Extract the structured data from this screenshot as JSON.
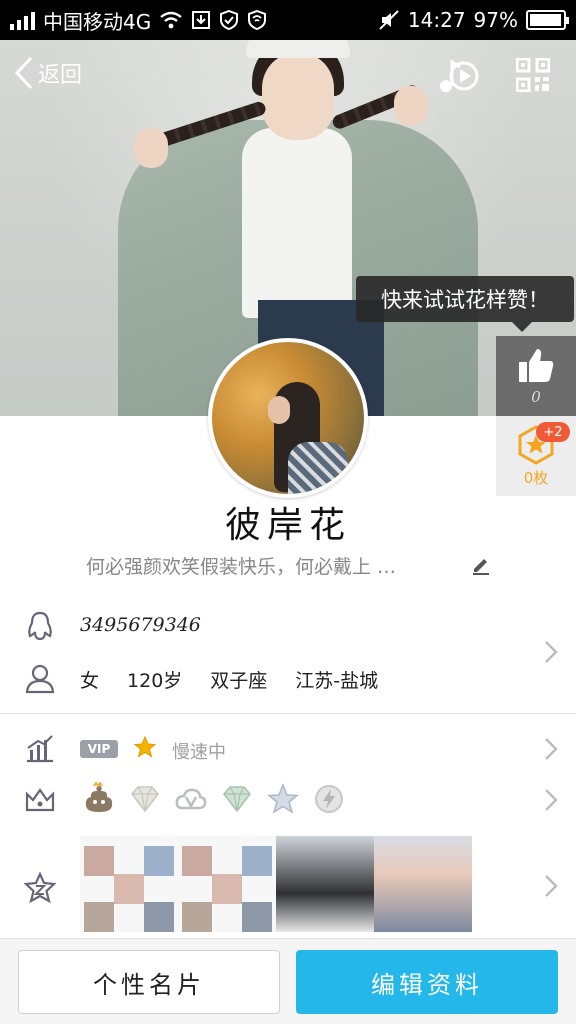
{
  "status_bar": {
    "carrier": "中国移动4G",
    "time": "14:27",
    "battery": "97%",
    "battery_level": 0.97
  },
  "header": {
    "back_label": "返回",
    "music_icon": "music-play-icon",
    "qr_icon": "qr-code-icon"
  },
  "tooltip": {
    "text": "快来试试花样赞！"
  },
  "like": {
    "count": "0",
    "icon": "thumbs-up-icon"
  },
  "coins": {
    "label": "0枚",
    "badge": "+2",
    "icon": "star-hexagon-icon"
  },
  "profile": {
    "nickname": "彼岸花",
    "signature": "何必强颜欢笑假装快乐，何必戴上 …",
    "qq_number": "3495679346",
    "gender": "女",
    "age": "120岁",
    "zodiac": "双子座",
    "location": "江苏-盐城"
  },
  "vip": {
    "tag": "VIP",
    "status": "慢速中"
  },
  "badges": [
    "poop-badge-icon",
    "diamond-badge-icon",
    "cloud-v-badge-icon",
    "green-diamond-badge-icon",
    "star-badge-icon",
    "lightning-badge-icon"
  ],
  "colors": {
    "accent": "#23b7ea",
    "coin": "#f5a623",
    "badge_red": "#f15a36"
  },
  "buttons": {
    "card": "个性名片",
    "edit": "编辑资料"
  }
}
